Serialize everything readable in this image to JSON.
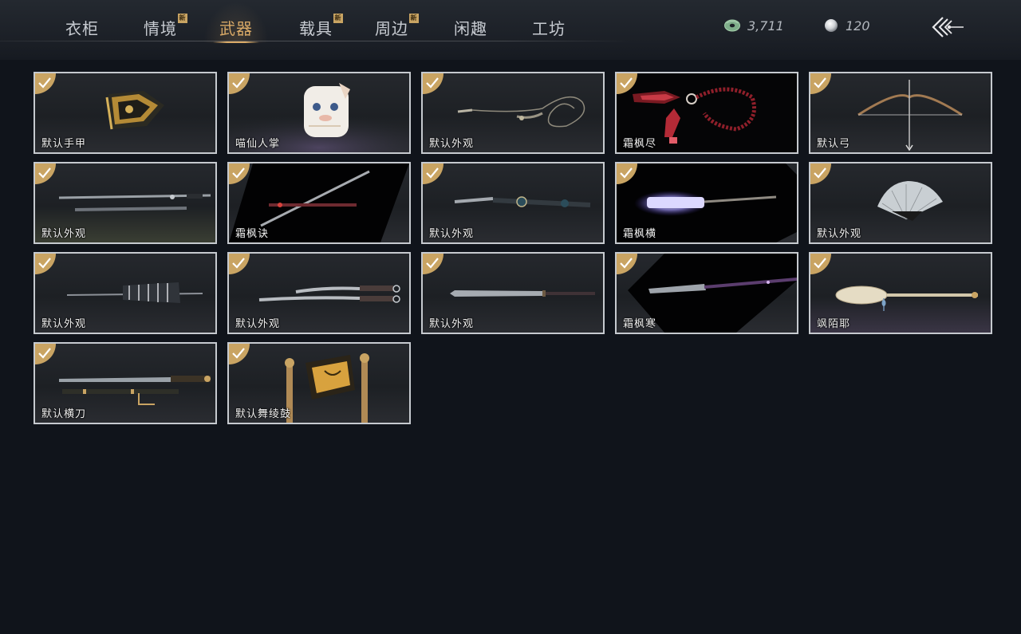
{
  "tabs": [
    {
      "label": "衣柜",
      "new": false,
      "active": false
    },
    {
      "label": "情境",
      "new": true,
      "active": false
    },
    {
      "label": "武器",
      "new": false,
      "active": true
    },
    {
      "label": "载具",
      "new": true,
      "active": false
    },
    {
      "label": "周边",
      "new": true,
      "active": false
    },
    {
      "label": "闲趣",
      "new": false,
      "active": false
    },
    {
      "label": "工坊",
      "new": false,
      "active": false
    }
  ],
  "new_badge": "新",
  "currency": {
    "jade_amount": "3,711",
    "pearl_amount": "120"
  },
  "items": [
    {
      "label": "默认手甲",
      "icon": "gauntlet-art",
      "selected": true
    },
    {
      "label": "喵仙人掌",
      "icon": "cat-paw-art",
      "selected": true
    },
    {
      "label": "默认外观",
      "icon": "rope-dart-art",
      "selected": true
    },
    {
      "label": "霜枫尽",
      "icon": "red-prayer-beads-art",
      "selected": true
    },
    {
      "label": "默认弓",
      "icon": "bow-art",
      "selected": true
    },
    {
      "label": "默认外观",
      "icon": "twin-spear-art",
      "selected": true
    },
    {
      "label": "霜枫诀",
      "icon": "red-staff-art",
      "selected": true
    },
    {
      "label": "默认外观",
      "icon": "ornate-spear-art",
      "selected": true
    },
    {
      "label": "霜枫横",
      "icon": "glowing-spear-art",
      "selected": true
    },
    {
      "label": "默认外观",
      "icon": "folding-fan-art",
      "selected": true
    },
    {
      "label": "默认外观",
      "icon": "umbrella-art",
      "selected": true
    },
    {
      "label": "默认外观",
      "icon": "twin-sabre-art",
      "selected": true
    },
    {
      "label": "默认外观",
      "icon": "long-blade-art",
      "selected": true
    },
    {
      "label": "霜枫寒",
      "icon": "frost-blade-art",
      "selected": true
    },
    {
      "label": "飒陌耶",
      "icon": "ivory-spoon-art",
      "selected": true
    },
    {
      "label": "默认横刀",
      "icon": "hengdao-sword-art",
      "selected": true
    },
    {
      "label": "默认舞绫鼓",
      "icon": "dance-drum-art",
      "selected": true
    }
  ],
  "colors": {
    "accent": "#d9aa67",
    "check_badge": "#c9a463",
    "card_border": "#c6cacf",
    "background": "#10141b"
  }
}
